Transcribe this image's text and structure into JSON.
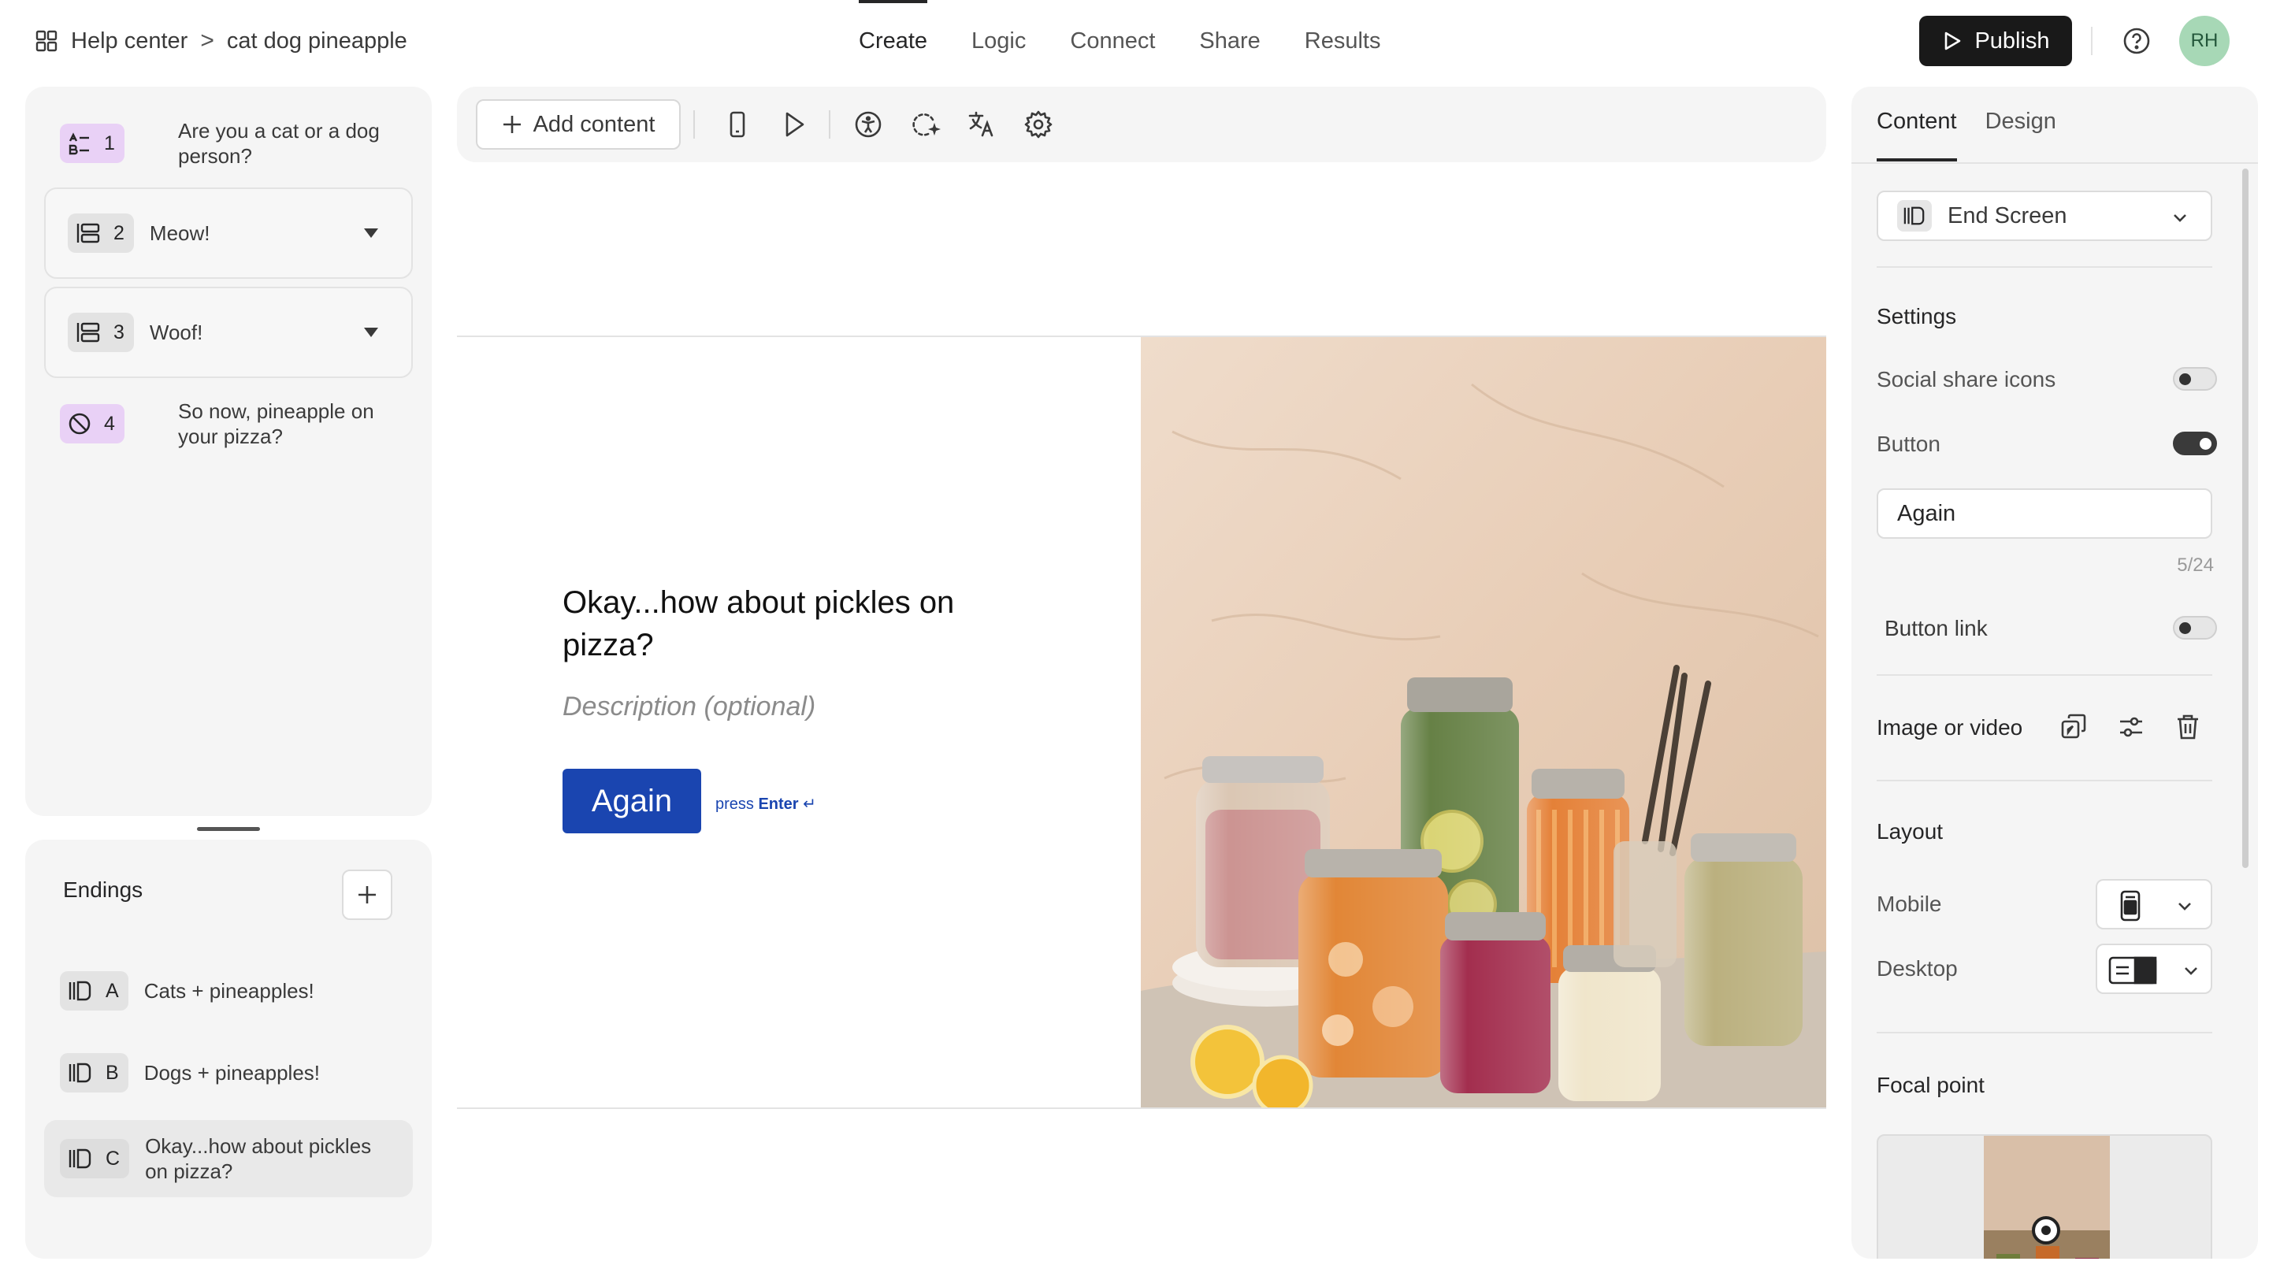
{
  "breadcrumb": {
    "root": "Help center",
    "separator": ">",
    "current": "cat dog pineapple"
  },
  "nav": {
    "tabs": [
      {
        "label": "Create",
        "active": true
      },
      {
        "label": "Logic"
      },
      {
        "label": "Connect"
      },
      {
        "label": "Share"
      },
      {
        "label": "Results"
      }
    ]
  },
  "header": {
    "publish_label": "Publish",
    "avatar_initials": "RH"
  },
  "questions": [
    {
      "number": "1",
      "label_line1": "Are you a cat or a dog",
      "label_line2": "person?",
      "icon": "multiple-choice-icon"
    },
    {
      "number": "2",
      "label": "Meow!",
      "icon": "group-icon"
    },
    {
      "number": "3",
      "label": "Woof!",
      "icon": "group-icon"
    },
    {
      "number": "4",
      "label_line1": "So now, pineapple on",
      "label_line2": "your pizza?",
      "icon": "no-symbol-icon"
    }
  ],
  "endings": {
    "title": "Endings",
    "items": [
      {
        "letter": "A",
        "label": "Cats + pineapples!"
      },
      {
        "letter": "B",
        "label": "Dogs + pineapples!"
      },
      {
        "letter": "C",
        "label_line1": "Okay...how about pickles",
        "label_line2": "on pizza?",
        "selected": true
      }
    ]
  },
  "toolbar": {
    "add_content_label": "Add content"
  },
  "preview": {
    "title": "Okay...how about pickles on pizza?",
    "description_placeholder": "Description (optional)",
    "button_label": "Again",
    "press_hint": "press",
    "press_key": "Enter",
    "press_glyph": "↵",
    "image": "pickle-jars-photo"
  },
  "right_panel": {
    "tabs": [
      {
        "label": "Content",
        "active": true
      },
      {
        "label": "Design"
      }
    ],
    "block_type": "End Screen",
    "settings_title": "Settings",
    "social_share_label": "Social share icons",
    "social_share_on": false,
    "button_label": "Button",
    "button_on": true,
    "button_text_value": "Again",
    "button_text_counter": "5/24",
    "button_link_label": "Button link",
    "button_link_on": false,
    "image_label": "Image or video",
    "layout_title": "Layout",
    "mobile_label": "Mobile",
    "desktop_label": "Desktop",
    "focal_title": "Focal point"
  },
  "colors": {
    "accent_button": "#1a45b0",
    "publish_bg": "#191919",
    "question_badge": "#e9d1f6",
    "avatar_bg": "#a7d8b6"
  }
}
